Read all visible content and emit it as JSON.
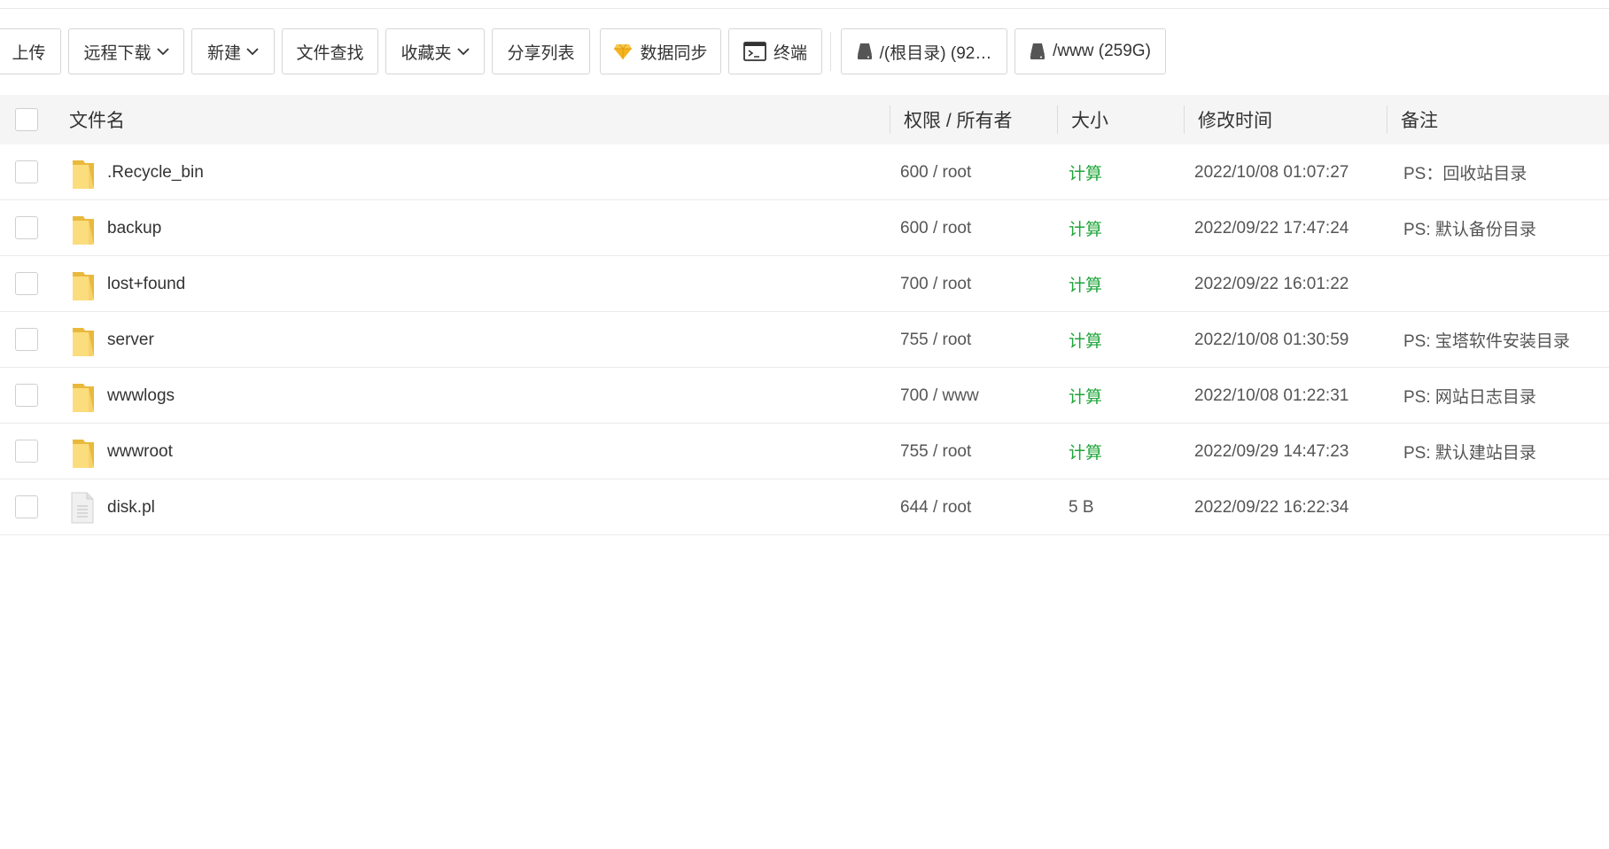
{
  "toolbar": {
    "upload_label": "上传",
    "remote_download_label": "远程下载",
    "new_label": "新建",
    "file_search_label": "文件查找",
    "favorites_label": "收藏夹",
    "share_list_label": "分享列表",
    "data_sync_label": "数据同步",
    "terminal_label": "终端",
    "disk_root_label": "/(根目录) (92…",
    "disk_www_label": "/www (259G)"
  },
  "table": {
    "headers": {
      "name": "文件名",
      "permission": "权限 / 所有者",
      "size": "大小",
      "mtime": "修改时间",
      "note": "备注"
    },
    "rows": [
      {
        "name": ".Recycle_bin",
        "type": "folder",
        "permission": "600 / root",
        "size": "计算",
        "mtime": "2022/10/08 01:07:27",
        "note": "PS：回收站目录"
      },
      {
        "name": "backup",
        "type": "folder",
        "permission": "600 / root",
        "size": "计算",
        "mtime": "2022/09/22 17:47:24",
        "note": "PS: 默认备份目录"
      },
      {
        "name": "lost+found",
        "type": "folder",
        "permission": "700 / root",
        "size": "计算",
        "mtime": "2022/09/22 16:01:22",
        "note": ""
      },
      {
        "name": "server",
        "type": "folder",
        "permission": "755 / root",
        "size": "计算",
        "mtime": "2022/10/08 01:30:59",
        "note": "PS: 宝塔软件安装目录"
      },
      {
        "name": "wwwlogs",
        "type": "folder",
        "permission": "700 / www",
        "size": "计算",
        "mtime": "2022/10/08 01:22:31",
        "note": "PS: 网站日志目录"
      },
      {
        "name": "wwwroot",
        "type": "folder",
        "permission": "755 / root",
        "size": "计算",
        "mtime": "2022/09/29 14:47:23",
        "note": "PS: 默认建站目录"
      },
      {
        "name": "disk.pl",
        "type": "file",
        "permission": "644 / root",
        "size": "5 B",
        "mtime": "2022/09/22 16:22:34",
        "note": ""
      }
    ]
  },
  "colors": {
    "accent_green": "#20a53a",
    "folder_yellow": "#f7d26a",
    "header_bg": "#f5f5f5"
  }
}
